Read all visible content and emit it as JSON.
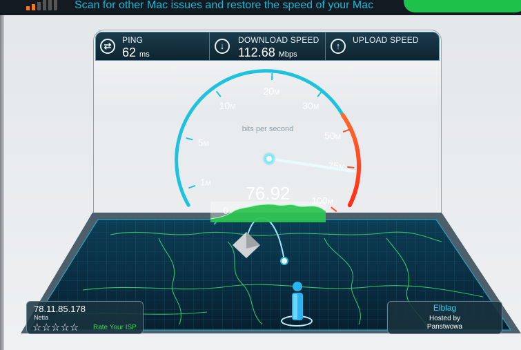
{
  "banner": {
    "text": "Scan for other Mac issues and restore the speed of your Mac"
  },
  "header": {
    "ping": {
      "label": "PING",
      "value": "62",
      "unit": "ms",
      "icon": "swap-arrows-icon"
    },
    "download": {
      "label": "DOWNLOAD SPEED",
      "value": "112.68",
      "unit": "Mbps",
      "icon": "arrow-down-icon"
    },
    "upload": {
      "label": "UPLOAD SPEED",
      "icon": "arrow-up-icon"
    }
  },
  "gauge": {
    "caption": "bits per second",
    "reading": "76.92",
    "scale_ticks": [
      {
        "label": "0",
        "unit": ""
      },
      {
        "label": "1",
        "unit": "M"
      },
      {
        "label": "5",
        "unit": "M"
      },
      {
        "label": "10",
        "unit": "M"
      },
      {
        "label": "20",
        "unit": "M"
      },
      {
        "label": "30",
        "unit": "M"
      },
      {
        "label": "50",
        "unit": "M"
      },
      {
        "label": "75",
        "unit": "M"
      },
      {
        "label": "100",
        "unit": "M"
      }
    ],
    "needle_value_mbps": 76.92
  },
  "isp": {
    "ip": "78.11.85.178",
    "name": "Netia",
    "rate_label": "Rate Your ISP",
    "stars": 5
  },
  "server": {
    "city": "Elblag",
    "hosted_label": "Hosted by",
    "host": "Panstwowa"
  },
  "colors": {
    "accent": "#1ec2dc",
    "red": "#ff3b1f",
    "graph": "#25c24a",
    "banner_text": "#1bb8d6"
  }
}
